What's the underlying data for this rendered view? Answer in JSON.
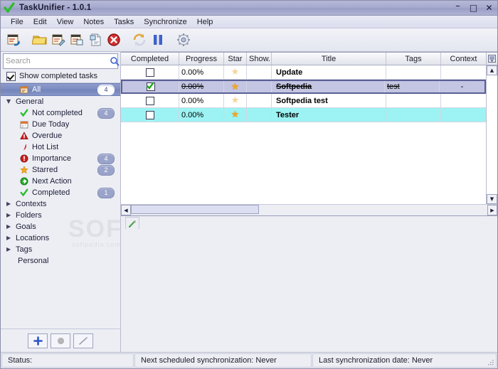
{
  "window": {
    "title": "TaskUnifier - 1.0.1",
    "app_icon": "green-check-icon",
    "minimize": "–",
    "maximize": "□",
    "close": "✕"
  },
  "menubar": {
    "items": [
      {
        "label": "File"
      },
      {
        "label": "Edit"
      },
      {
        "label": "View"
      },
      {
        "label": "Notes"
      },
      {
        "label": "Tasks"
      },
      {
        "label": "Synchronize"
      },
      {
        "label": "Help"
      }
    ]
  },
  "toolbar": {
    "buttons": [
      {
        "name": "add-task-icon",
        "title": "Add Task"
      },
      {
        "name": "add-folder-icon",
        "title": "Add Folder"
      },
      {
        "name": "edit-task-icon",
        "title": "Edit Task"
      },
      {
        "name": "delete-task-icon",
        "title": "Delete Task"
      },
      {
        "name": "copy-task-icon",
        "title": "Copy Task"
      },
      {
        "name": "remove-icon",
        "title": "Remove"
      },
      {
        "name": "synchronize-icon",
        "title": "Synchronize"
      },
      {
        "name": "pause-icon",
        "title": "Pause"
      },
      {
        "name": "settings-icon",
        "title": "Settings"
      }
    ]
  },
  "sidebar": {
    "search": {
      "value": "",
      "placeholder": "Search",
      "icon": "search-icon"
    },
    "show_completed": {
      "label": "Show completed tasks",
      "checked": true
    },
    "tree": [
      {
        "label": "All",
        "icon": "all-tasks-icon",
        "badge": "4",
        "level": 1,
        "selected": true,
        "arrow": ""
      },
      {
        "label": "General",
        "icon": "",
        "badge": "",
        "level": 0,
        "selected": false,
        "arrow": "▼"
      },
      {
        "label": "Not completed",
        "icon": "green-check-icon",
        "badge": "4",
        "level": 1,
        "selected": false,
        "arrow": ""
      },
      {
        "label": "Due Today",
        "icon": "calendar-icon",
        "badge": "",
        "level": 1,
        "selected": false,
        "arrow": ""
      },
      {
        "label": "Overdue",
        "icon": "warning-icon",
        "badge": "",
        "level": 1,
        "selected": false,
        "arrow": ""
      },
      {
        "label": "Hot List",
        "icon": "flame-icon",
        "badge": "",
        "level": 1,
        "selected": false,
        "arrow": ""
      },
      {
        "label": "Importance",
        "icon": "exclamation-icon",
        "badge": "4",
        "level": 1,
        "selected": false,
        "arrow": ""
      },
      {
        "label": "Starred",
        "icon": "star-icon",
        "badge": "2",
        "level": 1,
        "selected": false,
        "arrow": ""
      },
      {
        "label": "Next Action",
        "icon": "arrow-right-icon",
        "badge": "",
        "level": 1,
        "selected": false,
        "arrow": ""
      },
      {
        "label": "Completed",
        "icon": "green-check-icon",
        "badge": "1",
        "level": 1,
        "selected": false,
        "arrow": ""
      },
      {
        "label": "Contexts",
        "icon": "",
        "badge": "",
        "level": 0,
        "selected": false,
        "arrow": "▶"
      },
      {
        "label": "Folders",
        "icon": "",
        "badge": "",
        "level": 0,
        "selected": false,
        "arrow": "▶"
      },
      {
        "label": "Goals",
        "icon": "",
        "badge": "",
        "level": 0,
        "selected": false,
        "arrow": "▶"
      },
      {
        "label": "Locations",
        "icon": "",
        "badge": "",
        "level": 0,
        "selected": false,
        "arrow": "▶"
      },
      {
        "label": "Tags",
        "icon": "",
        "badge": "",
        "level": 0,
        "selected": false,
        "arrow": "▶"
      },
      {
        "label": "Personal",
        "icon": "",
        "badge": "",
        "level": 2,
        "selected": false,
        "arrow": ""
      }
    ],
    "footer_buttons": [
      {
        "name": "add-item-button",
        "icon": "plus-icon"
      },
      {
        "name": "remove-item-button",
        "icon": "circle-icon"
      },
      {
        "name": "edit-item-button",
        "icon": "pencil-icon"
      }
    ]
  },
  "table": {
    "columns": [
      {
        "label": "Completed",
        "width": 82
      },
      {
        "label": "Progress",
        "width": 63
      },
      {
        "label": "Star",
        "width": 32
      },
      {
        "label": "Show...",
        "width": 35
      },
      {
        "label": "Title",
        "width": 156
      },
      {
        "label": "Tags",
        "width": 77
      },
      {
        "label": "Context",
        "width": 63
      }
    ],
    "column_chooser_icon": "column-settings-icon",
    "rows": [
      {
        "completed": false,
        "progress": "0.00%",
        "starred": false,
        "show": "",
        "title": "Update",
        "tags": "",
        "context": "",
        "state": "normal",
        "strike": false
      },
      {
        "completed": true,
        "progress": "0.00%",
        "starred": true,
        "show": "",
        "title": "Softpedia",
        "tags": "test",
        "context": "-",
        "state": "selected",
        "strike": true
      },
      {
        "completed": false,
        "progress": "0.00%",
        "starred": false,
        "show": "",
        "title": "Softpedia test",
        "tags": "",
        "context": "",
        "state": "normal",
        "strike": false
      },
      {
        "completed": false,
        "progress": "0.00%",
        "starred": true,
        "show": "",
        "title": "Tester",
        "tags": "",
        "context": "",
        "state": "highlighted",
        "strike": false
      }
    ],
    "scroll_up": "▲",
    "scroll_down": "▼",
    "scroll_left": "◀",
    "scroll_right": "▶"
  },
  "detail": {
    "tabs": [
      {
        "name": "edit-tab",
        "icon": "pencil-icon"
      }
    ]
  },
  "statusbar": {
    "status": "Status:",
    "next_sync": "Next scheduled synchronization: Never",
    "last_sync": "Last synchronization date: Never"
  },
  "watermark": {
    "text": "SOFTPEDIA",
    "sub": "softpedia.com"
  },
  "colors": {
    "titlebar": "#a7abce",
    "selection": "#7b8bc0",
    "row_selected": "#c3c5e2",
    "row_highlight": "#9df3f3",
    "star_on": "#f5a623",
    "badge": "#9aa4ca"
  }
}
